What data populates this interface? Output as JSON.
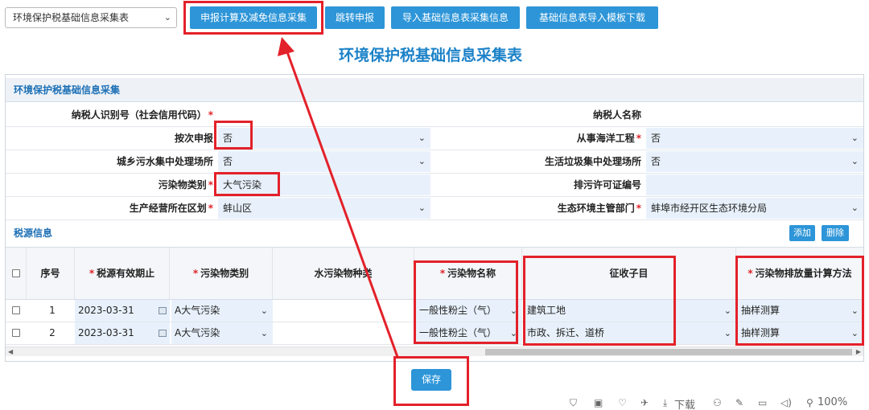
{
  "toolbar": {
    "doc_select": "环境保护税基础信息采集表",
    "buttons": [
      "申报计算及减免信息采集",
      "跳转申报",
      "导入基础信息表采集信息",
      "基础信息表导入模板下载"
    ]
  },
  "page_title": "环境保护税基础信息采集表",
  "section_basic": "环境保护税基础信息采集",
  "fields": {
    "taxpayer_id_label": "纳税人识别号（社会信用代码）",
    "taxpayer_name_label": "纳税人名称",
    "per_filing_label": "按次申报",
    "per_filing_value": "否",
    "marine_label": "从事海洋工程",
    "marine_value": "否",
    "sewage_label": "城乡污水集中处理场所",
    "sewage_value": "否",
    "garbage_label": "生活垃圾集中处理场所",
    "garbage_value": "否",
    "pollutant_type_label": "污染物类别",
    "pollutant_type_value": "大气污染",
    "permit_label": "排污许可证编号",
    "district_label": "生产经营所在区划",
    "district_value": "蚌山区",
    "dept_label": "生态环境主管部门",
    "dept_value": "蚌埠市经开区生态环境分局"
  },
  "section_source": "税源信息",
  "source_buttons": {
    "add": "添加",
    "delete": "删除"
  },
  "table": {
    "headers": [
      "序号",
      "税源有效期止",
      "污染物类别",
      "水污染物种类",
      "污染物名称",
      "征收子目",
      "污染物排放量计算方法"
    ],
    "rows": [
      {
        "no": "1",
        "date": "2023-03-31",
        "category": "A大气污染",
        "name": "一般性粉尘（气）",
        "subitem": "建筑工地",
        "method": "抽样测算"
      },
      {
        "no": "2",
        "date": "2023-03-31",
        "category": "A大气污染",
        "name": "一般性粉尘（气）",
        "subitem": "市政、拆迁、道桥",
        "method": "抽样测算"
      }
    ]
  },
  "save_label": "保存",
  "statusbar": {
    "download": "下载",
    "zoom": "100%"
  }
}
